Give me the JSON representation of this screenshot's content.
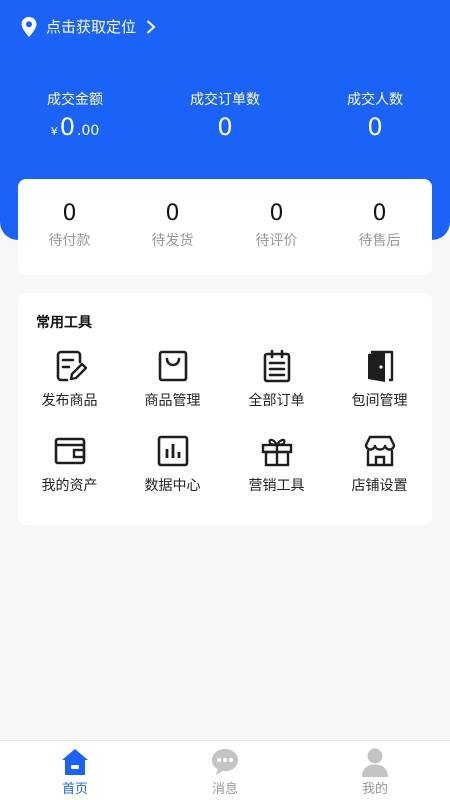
{
  "colors": {
    "primary": "#1b63f6",
    "background": "#f7f7f7",
    "muted": "#9a9a9a",
    "icon_dark": "#1e1e1e"
  },
  "location": {
    "text": "点击获取定位",
    "icon": "location-pin-icon"
  },
  "stats": {
    "amount": {
      "label": "成交金额",
      "currency": "¥",
      "integer": "0",
      "decimal": ".00"
    },
    "orders": {
      "label": "成交订单数",
      "value": "0"
    },
    "people": {
      "label": "成交人数",
      "value": "0"
    }
  },
  "order_status": [
    {
      "num": "0",
      "label": "待付款"
    },
    {
      "num": "0",
      "label": "待发货"
    },
    {
      "num": "0",
      "label": "待评价"
    },
    {
      "num": "0",
      "label": "待售后"
    }
  ],
  "tools": {
    "title": "常用工具",
    "items": [
      {
        "label": "发布商品",
        "icon": "edit-doc-icon"
      },
      {
        "label": "商品管理",
        "icon": "shopping-bag-icon"
      },
      {
        "label": "全部订单",
        "icon": "clipboard-icon"
      },
      {
        "label": "包间管理",
        "icon": "door-icon"
      },
      {
        "label": "我的资产",
        "icon": "wallet-icon"
      },
      {
        "label": "数据中心",
        "icon": "bar-chart-icon"
      },
      {
        "label": "营销工具",
        "icon": "gift-icon"
      },
      {
        "label": "店铺设置",
        "icon": "store-icon"
      }
    ]
  },
  "tabbar": [
    {
      "label": "首页",
      "icon": "home-icon",
      "active": true
    },
    {
      "label": "消息",
      "icon": "message-icon",
      "active": false
    },
    {
      "label": "我的",
      "icon": "user-icon",
      "active": false
    }
  ]
}
